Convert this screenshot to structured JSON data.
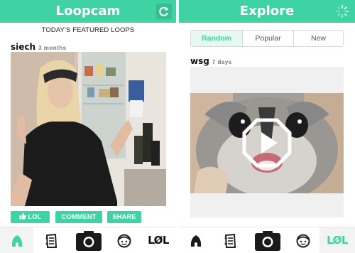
{
  "left_screen": {
    "header": {
      "title": "Loopcam",
      "refresh_icon": "refresh-icon"
    },
    "featured_label": "TODAY'S FEATURED LOOPS",
    "post": {
      "username": "siech",
      "time_ago": "3 months"
    },
    "actions": {
      "lol_label": "LOL",
      "comment_label": "COMMENT",
      "share_label": "SHARE"
    },
    "tabbar": {
      "items": [
        {
          "icon": "home-icon",
          "active": true
        },
        {
          "icon": "feed-list-icon"
        },
        {
          "icon": "camera-icon"
        },
        {
          "icon": "profile-face-icon"
        },
        {
          "label": "LØL"
        }
      ]
    }
  },
  "right_screen": {
    "header": {
      "title": "Explore",
      "loading_icon": "loading-spinner-icon"
    },
    "tabs": [
      {
        "label": "Random",
        "selected": true
      },
      {
        "label": "Popular",
        "selected": false
      },
      {
        "label": "New",
        "selected": false
      }
    ],
    "post": {
      "username": "wsg",
      "time_ago": "7 days",
      "play_icon": "play-icon"
    },
    "tabbar": {
      "items": [
        {
          "icon": "home-icon"
        },
        {
          "icon": "feed-list-icon"
        },
        {
          "icon": "camera-icon"
        },
        {
          "icon": "profile-face-icon"
        },
        {
          "label": "LØL",
          "active": true
        }
      ]
    }
  },
  "colors": {
    "accent": "#3fd3a3",
    "accent_dark": "#36bd90",
    "text": "#111111"
  }
}
